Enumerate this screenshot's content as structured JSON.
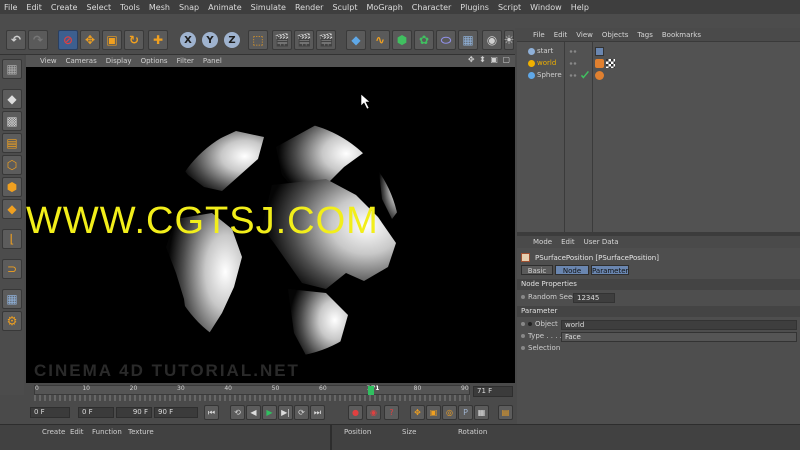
{
  "menubar": [
    "File",
    "Edit",
    "Create",
    "Select",
    "Tools",
    "Mesh",
    "Snap",
    "Animate",
    "Simulate",
    "Render",
    "Sculpt",
    "MoGraph",
    "Character",
    "Plugins",
    "Script",
    "Window",
    "Help"
  ],
  "toolbar": {
    "axis_x": "X",
    "axis_y": "Y",
    "axis_z": "Z"
  },
  "viewport": {
    "menu": [
      "View",
      "Cameras",
      "Display",
      "Options",
      "Filter",
      "Panel"
    ],
    "nav_icons": "✥ ⬍ ▣ ▢",
    "watermark": "WWW.CGTSJ.COM",
    "logo_text": "CINEMA 4D TUTORIAL.NET"
  },
  "timeline": {
    "ticks": [
      "0",
      "10",
      "20",
      "30",
      "40",
      "50",
      "60",
      "70",
      "71",
      "80",
      "90"
    ],
    "current_frame": 71,
    "max_frame": 90,
    "current_field": "71 F",
    "start_field": "0 F",
    "min_field": "0 F",
    "max_field": "90 F",
    "end_field": "90 F"
  },
  "bottombar": {
    "left_menu": [
      "Create",
      "Edit",
      "Function",
      "Texture"
    ],
    "right_cols": [
      "Position",
      "Size",
      "Rotation"
    ]
  },
  "object_manager": {
    "menu": [
      "File",
      "Edit",
      "View",
      "Objects",
      "Tags",
      "Bookmarks"
    ],
    "objects": [
      {
        "name": "start",
        "color": "#8fb0d8"
      },
      {
        "name": "world",
        "color": "#f0b000"
      },
      {
        "name": "Sphere",
        "color": "#5fa8e8"
      }
    ]
  },
  "attribute_manager": {
    "menu": [
      "Mode",
      "Edit",
      "User Data"
    ],
    "node_title": "PSurfacePosition [PSurfacePosition]",
    "tabs": [
      "Basic",
      "Node",
      "Parameter"
    ],
    "node_properties": {
      "section": "Node Properties",
      "random_seed_label": "Random Seed",
      "random_seed_value": "12345"
    },
    "parameter": {
      "section": "Parameter",
      "object_label": "Object",
      "object_value": "world",
      "type_label": "Type . . . .",
      "type_value": "Face",
      "selection_label": "Selection"
    }
  },
  "colors": {
    "watermark": "#f2ee1a",
    "accent_blue": "#3d5f8f",
    "timeline_marker": "#30c060"
  }
}
